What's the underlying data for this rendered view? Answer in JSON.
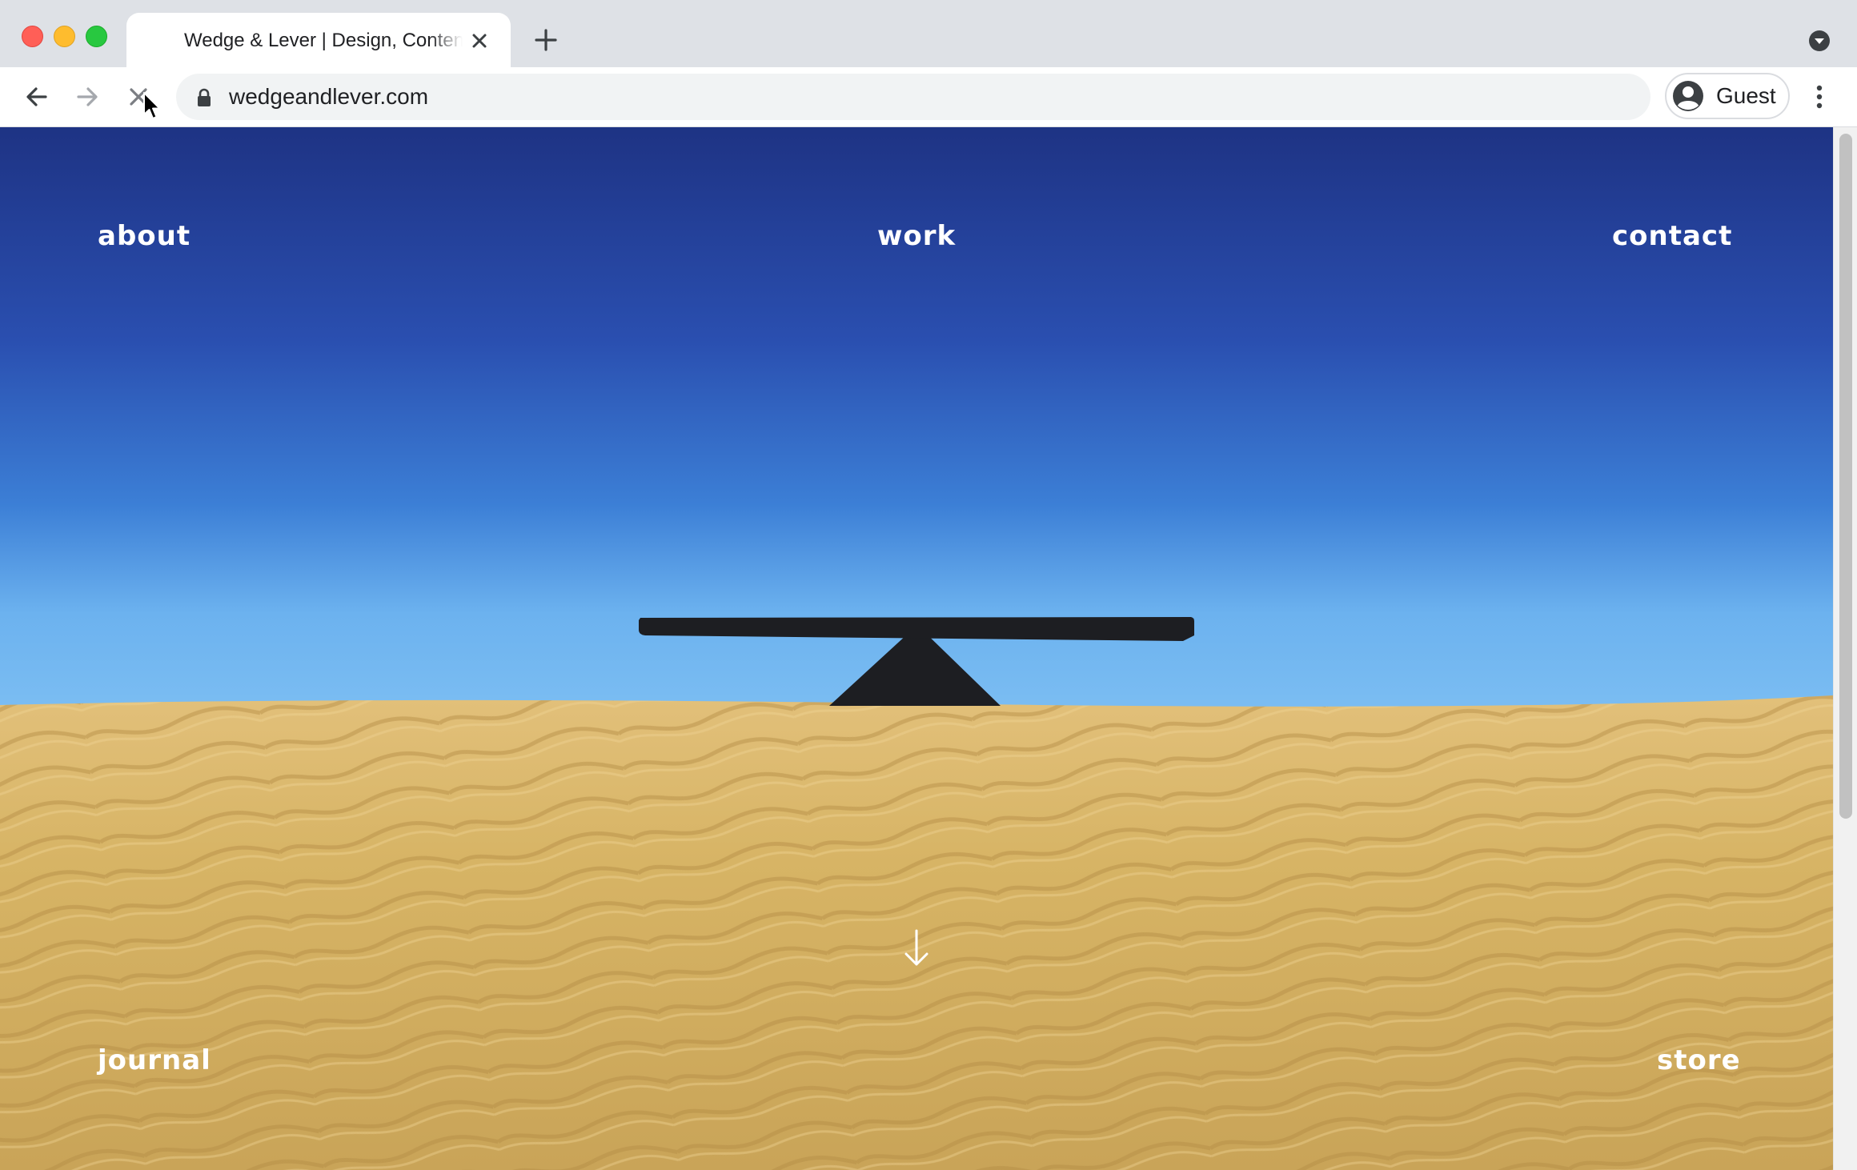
{
  "browser": {
    "tab": {
      "title": "Wedge & Lever | Design, Content & Strategy"
    },
    "omnibox": {
      "url": "wedgeandlever.com"
    },
    "profile": {
      "label": "Guest"
    }
  },
  "page": {
    "nav": {
      "about": "about",
      "work": "work",
      "contact": "contact",
      "journal": "journal",
      "store": "store"
    }
  },
  "colors": {
    "sky_top": "#1e3384",
    "sky_bottom": "#6cb2ef",
    "sand": "#d7b465",
    "sculpture": "#1d1e22",
    "nav_text": "#ffffff"
  },
  "icons": {
    "back": "arrow-left-icon",
    "forward": "arrow-right-icon",
    "stop": "close-icon",
    "lock": "lock-icon",
    "new_tab": "plus-icon",
    "tab_search": "chevron-down-icon",
    "menu": "kebab-menu-icon",
    "scroll_down": "arrow-down-icon"
  }
}
